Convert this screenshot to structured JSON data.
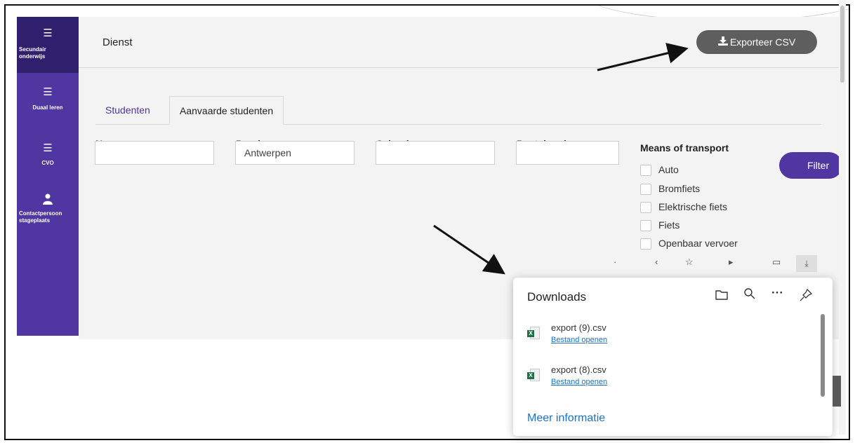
{
  "sidebar": {
    "items": [
      {
        "icon": "list-icon",
        "label_line1": "Secundair",
        "label_line2": "onderwijs"
      },
      {
        "icon": "list-icon",
        "label_line1": "Duaal leren",
        "label_line2": ""
      },
      {
        "icon": "list-icon",
        "label_line1": "CVO",
        "label_line2": ""
      },
      {
        "icon": "contact-person-icon",
        "label_line1": "Contactpersoon",
        "label_line2": "stageplaats"
      }
    ]
  },
  "header": {
    "title": "Dienst",
    "export_label": "Exporteer CSV"
  },
  "tabs": [
    {
      "label": "Studenten"
    },
    {
      "label": "Aanvaarde studenten"
    }
  ],
  "filters": {
    "name": {
      "label": "Name",
      "value": ""
    },
    "province": {
      "label": "Province",
      "value": "Antwerpen"
    },
    "school": {
      "label": "School",
      "value": ""
    },
    "postal_code": {
      "label": "Postal code",
      "value": ""
    },
    "transport": {
      "label": "Means of transport",
      "options": [
        "Auto",
        "Bromfiets",
        "Elektrische fiets",
        "Fiets",
        "Openbaar vervoer"
      ]
    },
    "filter_button": "Filter"
  },
  "downloads": {
    "title": "Downloads",
    "items": [
      {
        "name": "export (9).csv",
        "action": "Bestand openen"
      },
      {
        "name": "export (8).csv",
        "action": "Bestand openen"
      }
    ],
    "more_label": "Meer informatie"
  },
  "colors": {
    "sidebar": "#4f36a0",
    "sidebar_active": "#2f206e",
    "export_button": "#5e5e5e",
    "link": "#1a73c7"
  }
}
